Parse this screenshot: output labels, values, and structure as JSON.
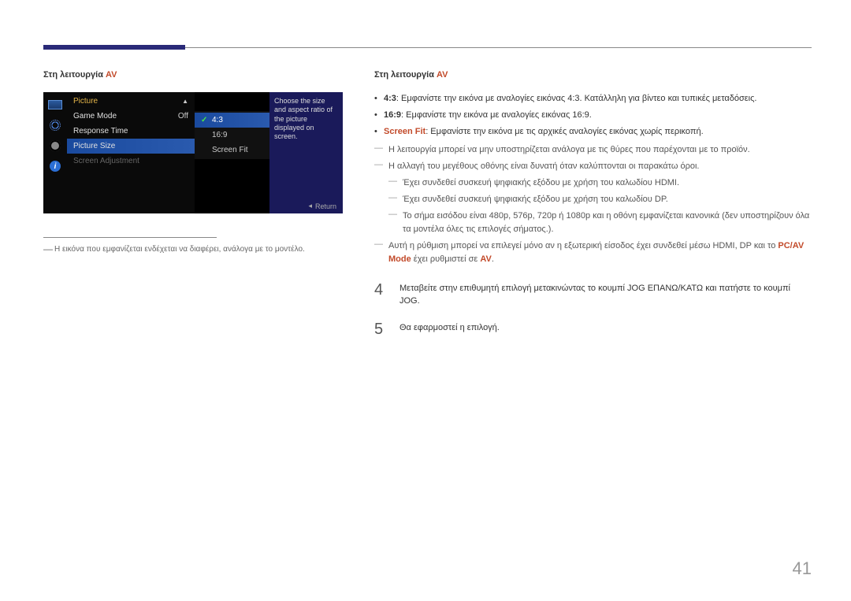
{
  "left": {
    "mode_label_prefix": "Στη λειτουργία ",
    "mode_label_av": "AV",
    "osd": {
      "section_title": "Picture",
      "items": {
        "game_mode": {
          "label": "Game Mode",
          "value": "Off"
        },
        "response_time": {
          "label": "Response Time"
        },
        "picture_size": {
          "label": "Picture Size"
        },
        "screen_adjustment": {
          "label": "Screen Adjustment"
        }
      },
      "options": {
        "r43": "4:3",
        "r169": "16:9",
        "screen_fit": "Screen Fit"
      },
      "help_text": "Choose the size and aspect ratio of the picture displayed on screen.",
      "return_label": "Return"
    },
    "footnote": "Η εικόνα που εμφανίζεται ενδέχεται να διαφέρει, ανάλογα με το μοντέλο."
  },
  "right": {
    "mode_label_prefix": "Στη λειτουργία ",
    "mode_label_av": "AV",
    "bullets": {
      "b43_label": "4:3",
      "b43_text": ": Εμφανίστε την εικόνα με αναλογίες εικόνας 4:3. Κατάλληλη για βίντεο και τυπικές μεταδόσεις.",
      "b169_label": "16:9",
      "b169_text": ": Εμφανίστε την εικόνα με αναλογίες εικόνας 16:9.",
      "bfit_label": "Screen Fit",
      "bfit_text": ": Εμφανίστε την εικόνα με τις αρχικές αναλογίες εικόνας χωρίς περικοπή."
    },
    "dashes": {
      "d1": "Η λειτουργία μπορεί να μην υποστηρίζεται ανάλογα με τις θύρες που παρέχονται με το προϊόν.",
      "d2": "Η αλλαγή του μεγέθους οθόνης είναι δυνατή όταν καλύπτονται οι παρακάτω όροι.",
      "d2a": "Έχει συνδεθεί συσκευή ψηφιακής εξόδου με χρήση του καλωδίου HDMI.",
      "d2b": "Έχει συνδεθεί συσκευή ψηφιακής εξόδου με χρήση του καλωδίου DP.",
      "d2c": "Το σήμα εισόδου είναι 480p, 576p, 720p ή 1080p και η οθόνη εμφανίζεται κανονικά (δεν υποστηρίζουν όλα τα μοντέλα όλες τις επιλογές σήματος.).",
      "d3_pre": "Αυτή η ρύθμιση μπορεί να επιλεγεί μόνο αν η εξωτερική είσοδος έχει συνδεθεί μέσω HDMI, DP και το ",
      "d3_pcav": "PC/AV Mode",
      "d3_mid": " έχει ρυθμιστεί σε ",
      "d3_av": "AV",
      "d3_post": "."
    },
    "steps": {
      "s4_num": "4",
      "s4_text": "Μεταβείτε στην επιθυμητή επιλογή μετακινώντας το κουμπί JOG ΕΠΑΝΩ/ΚΑΤΩ και πατήστε το κουμπί JOG.",
      "s5_num": "5",
      "s5_text": "Θα εφαρμοστεί η επιλογή."
    }
  },
  "page_number": "41"
}
